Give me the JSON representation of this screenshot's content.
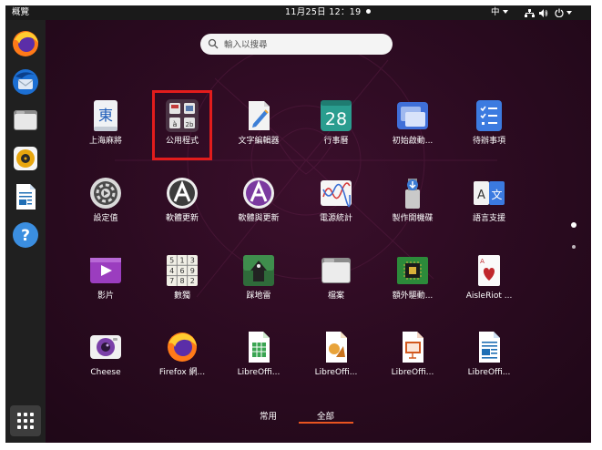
{
  "topbar": {
    "activities_label": "概覽",
    "clock_label": "11月25日  12：19",
    "input_method": "中",
    "status_icon_names": [
      "network-icon",
      "volume-icon",
      "power-icon",
      "system-menu-chevron-icon"
    ]
  },
  "dock": {
    "items": [
      {
        "name": "Firefox",
        "icon": "firefox-icon"
      },
      {
        "name": "Thunderbird",
        "icon": "thunderbird-icon"
      },
      {
        "name": "Files",
        "icon": "files-icon"
      },
      {
        "name": "Rhythmbox",
        "icon": "rhythmbox-icon"
      },
      {
        "name": "LibreOffice Writer",
        "icon": "writer-icon"
      },
      {
        "name": "Help",
        "icon": "help-icon"
      }
    ],
    "show_apps_icon": "grid-icon"
  },
  "search": {
    "placeholder": "輸入以搜尋",
    "value": ""
  },
  "apps": [
    {
      "label": "上海麻將",
      "icon": "mahjongg-icon"
    },
    {
      "label": "公用程式",
      "icon": "utilities-folder-icon"
    },
    {
      "label": "文字編輯器",
      "icon": "text-editor-icon"
    },
    {
      "label": "行事曆",
      "icon": "calendar-icon",
      "badge": "28"
    },
    {
      "label": "初始啟動...",
      "icon": "startup-apps-icon"
    },
    {
      "label": "待辦事項",
      "icon": "todo-icon"
    },
    {
      "label": "設定值",
      "icon": "settings-icon"
    },
    {
      "label": "軟體更新",
      "icon": "software-updater-icon"
    },
    {
      "label": "軟體與更新",
      "icon": "software-properties-icon"
    },
    {
      "label": "電源統計",
      "icon": "power-statistics-icon"
    },
    {
      "label": "製作開機碟",
      "icon": "startup-disk-icon"
    },
    {
      "label": "語言支援",
      "icon": "language-support-icon"
    },
    {
      "label": "影片",
      "icon": "videos-icon"
    },
    {
      "label": "數獨",
      "icon": "sudoku-icon"
    },
    {
      "label": "踩地雷",
      "icon": "mines-icon"
    },
    {
      "label": "檔案",
      "icon": "files-icon"
    },
    {
      "label": "額外驅動...",
      "icon": "additional-drivers-icon"
    },
    {
      "label": "AisleRiot ...",
      "icon": "aisleriot-icon"
    },
    {
      "label": "Cheese",
      "icon": "cheese-icon"
    },
    {
      "label": "Firefox 網...",
      "icon": "firefox-icon"
    },
    {
      "label": "LibreOffi...",
      "icon": "libreoffice-calc-icon"
    },
    {
      "label": "LibreOffi...",
      "icon": "libreoffice-draw-icon"
    },
    {
      "label": "LibreOffi...",
      "icon": "libreoffice-impress-icon"
    },
    {
      "label": "LibreOffi...",
      "icon": "libreoffice-writer-icon"
    }
  ],
  "mahjongg_glyph": "東",
  "sudoku_digits": [
    "5",
    "1",
    "3",
    "4",
    "6",
    "9",
    "7",
    "8",
    "2"
  ],
  "highlight_color": "#e21c1c",
  "tabs": {
    "frequent": "常用",
    "all": "全部",
    "active": "all",
    "accent": "#e95420"
  },
  "page_indicator": {
    "pages": 2,
    "current": 1
  }
}
